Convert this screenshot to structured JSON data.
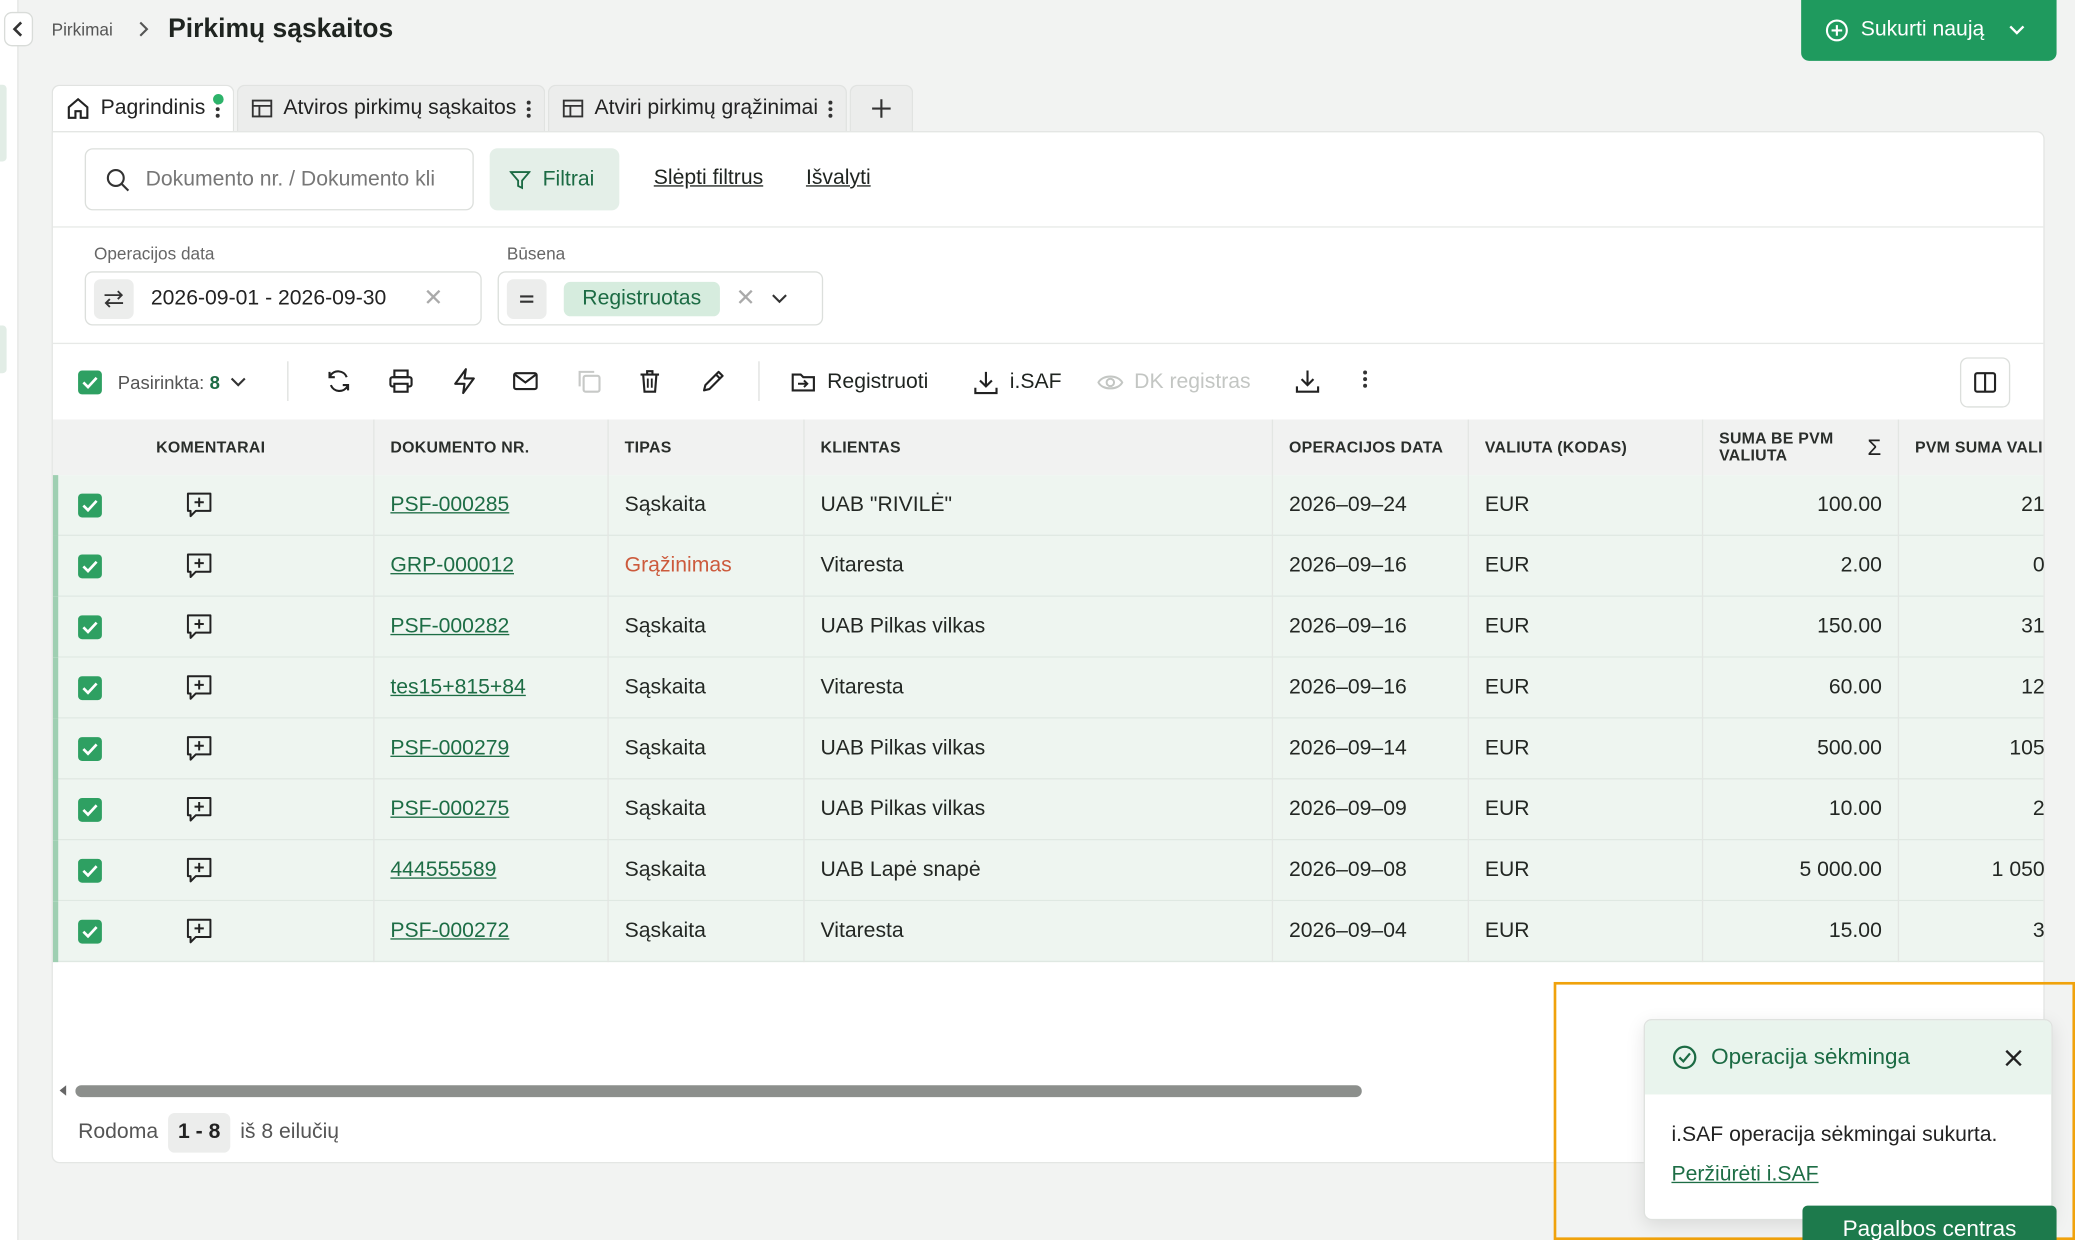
{
  "header": {
    "breadcrumb": "Pirkimai",
    "title": "Pirkimų sąskaitos",
    "create_label": "Sukurti naują"
  },
  "tabs": [
    {
      "label": "Pagrindinis",
      "active": true,
      "has_dot": true
    },
    {
      "label": "Atviros pirkimų sąskaitos",
      "active": false
    },
    {
      "label": "Atviri pirkimų grąžinimai",
      "active": false
    }
  ],
  "filters": {
    "search_placeholder": "Dokumento nr. / Dokumento kli",
    "filter_label": "Filtrai",
    "hide_label": "Slėpti filtrus",
    "clear_label": "Išvalyti",
    "date_label": "Operacijos data",
    "date_value": "2026-09-01 - 2026-09-30",
    "status_label": "Būsena",
    "status_value": "Registruotas"
  },
  "toolbar": {
    "selected_label": "Pasirinkta:",
    "selected_count": "8",
    "register_label": "Registruoti",
    "isaf_label": "i.SAF",
    "dk_label": "DK registras"
  },
  "table": {
    "columns": [
      "KOMENTARAI",
      "DOKUMENTO NR.",
      "TIPAS",
      "KLIENTAS",
      "OPERACIJOS DATA",
      "VALIUTA (KODAS)",
      "SUMA BE PVM VALIUTA",
      "PVM SUMA VALI"
    ],
    "rows": [
      {
        "doc": "PSF-000285",
        "type": "Sąskaita",
        "client": "UAB \"RIVILĖ\"",
        "date": "2026–09–24",
        "currency": "EUR",
        "amount": "100.00",
        "vat": "21"
      },
      {
        "doc": "GRP-000012",
        "type": "Grąžinimas",
        "client": "Vitaresta",
        "date": "2026–09–16",
        "currency": "EUR",
        "amount": "2.00",
        "vat": "0"
      },
      {
        "doc": "PSF-000282",
        "type": "Sąskaita",
        "client": "UAB Pilkas vilkas",
        "date": "2026–09–16",
        "currency": "EUR",
        "amount": "150.00",
        "vat": "31"
      },
      {
        "doc": "tes15+815+84",
        "type": "Sąskaita",
        "client": "Vitaresta",
        "date": "2026–09–16",
        "currency": "EUR",
        "amount": "60.00",
        "vat": "12"
      },
      {
        "doc": "PSF-000279",
        "type": "Sąskaita",
        "client": "UAB Pilkas vilkas",
        "date": "2026–09–14",
        "currency": "EUR",
        "amount": "500.00",
        "vat": "105"
      },
      {
        "doc": "PSF-000275",
        "type": "Sąskaita",
        "client": "UAB Pilkas vilkas",
        "date": "2026–09–09",
        "currency": "EUR",
        "amount": "10.00",
        "vat": "2"
      },
      {
        "doc": "444555589",
        "type": "Sąskaita",
        "client": "UAB Lapė snapė",
        "date": "2026–09–08",
        "currency": "EUR",
        "amount": "5 000.00",
        "vat": "1 050"
      },
      {
        "doc": "PSF-000272",
        "type": "Sąskaita",
        "client": "Vitaresta",
        "date": "2026–09–04",
        "currency": "EUR",
        "amount": "15.00",
        "vat": "3"
      }
    ]
  },
  "pager": {
    "shown_label": "Rodoma",
    "range": "1 - 8",
    "total_label": "iš 8 eilučių"
  },
  "toast": {
    "title": "Operacija sėkminga",
    "message": "i.SAF operacija sėkmingai sukurta.",
    "link": "Peržiūrėti i.SAF"
  },
  "help_label": "Pagalbos centras",
  "colors": {
    "brand_green": "#1f9a5e",
    "row_selected": "#eef5f0",
    "return_red": "#cc5a3c",
    "highlight_orange": "#f0a20c"
  }
}
